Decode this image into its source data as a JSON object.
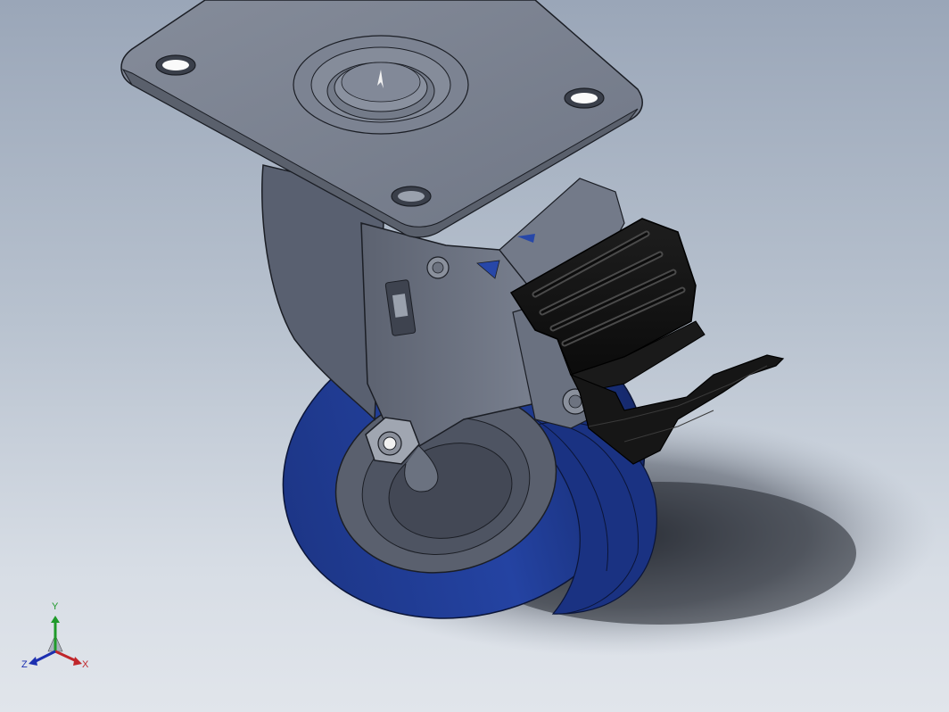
{
  "viewport": {
    "background_top": "#9aa6b8",
    "background_bottom": "#e1e5eb"
  },
  "model": {
    "plate_color": "#7d8594",
    "fork_color": "#6a7180",
    "wheel_tread_color": "#1f3a8e",
    "hub_color": "#5b6170",
    "brake_pedal_color": "#121212"
  },
  "triad": {
    "x_label": "X",
    "y_label": "Y",
    "z_label": "Z",
    "x_color": "#c0262b",
    "y_color": "#1f9a2a",
    "z_color": "#1c2fb0"
  }
}
